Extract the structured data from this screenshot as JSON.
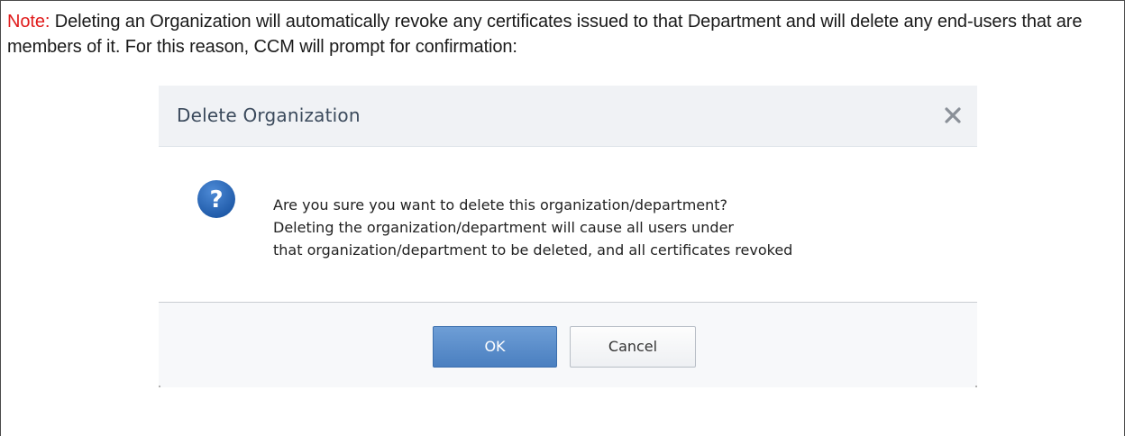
{
  "note": {
    "label": "Note:",
    "text": " Deleting an Organization will automatically revoke any certificates issued to that Department and will delete any end-users that are members of it. For this reason, CCM will prompt for confirmation:"
  },
  "dialog": {
    "title": "Delete Organization",
    "close_icon": "close-icon",
    "help_icon": "question-icon",
    "message_lines": [
      "Are you sure you want to delete this organization/department?",
      "Deleting the organization/department will cause all users under",
      "that organization/department to be deleted, and all certificates revoked"
    ],
    "buttons": {
      "ok": "OK",
      "cancel": "Cancel"
    }
  },
  "colors": {
    "note_label": "#e01b1b",
    "header_bg": "#f0f2f5",
    "ok_button": "#4a7fc0",
    "help_icon": "#2a64b4"
  }
}
